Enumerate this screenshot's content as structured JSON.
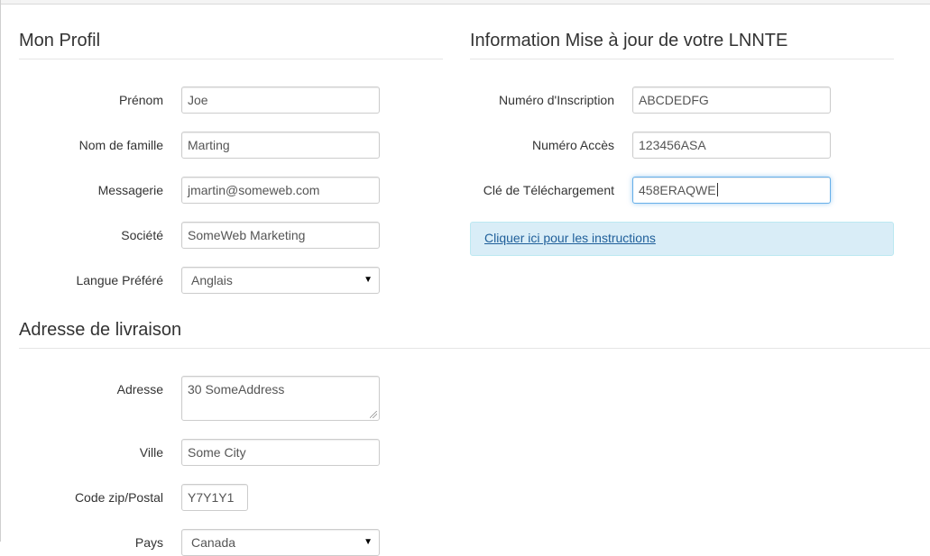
{
  "profile": {
    "title": "Mon Profil",
    "fields": [
      {
        "label": "Prénom",
        "value": "Joe"
      },
      {
        "label": "Nom de famille",
        "value": "Marting"
      },
      {
        "label": "Messagerie",
        "value": "jmartin@someweb.com"
      },
      {
        "label": "Société",
        "value": "SomeWeb Marketing"
      },
      {
        "label": "Langue Préféré",
        "value": "Anglais"
      }
    ]
  },
  "lnnte": {
    "title": "Information Mise à jour de votre LNNTE",
    "fields": [
      {
        "label": "Numéro d'Inscription",
        "value": "ABCDEDFG"
      },
      {
        "label": "Numéro Accès",
        "value": "123456ASA"
      },
      {
        "label": "Clé de Téléchargement",
        "value": "458ERAQWE"
      }
    ],
    "instructions_link": "Cliquer ici pour les instructions"
  },
  "shipping": {
    "title": "Adresse de livraison",
    "fields": [
      {
        "label": "Adresse",
        "value": "30 SomeAddress"
      },
      {
        "label": "Ville",
        "value": "Some City"
      },
      {
        "label": "Code zip/Postal",
        "value": "Y7Y1Y1"
      },
      {
        "label": "Pays",
        "value": "Canada"
      }
    ]
  }
}
